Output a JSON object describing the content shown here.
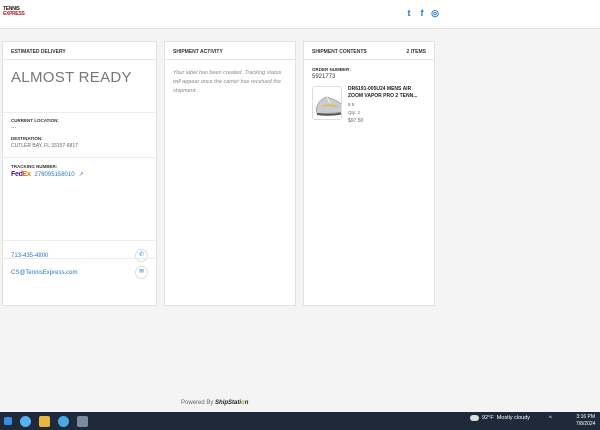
{
  "header": {
    "logo_line1": "TENNIS",
    "logo_line2": "EXPRESS",
    "social": [
      {
        "icon": "twitter-icon",
        "glyph": "t"
      },
      {
        "icon": "facebook-icon",
        "glyph": "f"
      },
      {
        "icon": "instagram-icon",
        "glyph": "◎"
      }
    ]
  },
  "delivery": {
    "heading": "ESTIMATED DELIVERY",
    "status": "ALMOST READY",
    "current_location_label": "CURRENT LOCATION:",
    "current_location_value": "---",
    "destination_label": "DESTINATION:",
    "destination_value": "CUTLER BAY, FL 33157-6817",
    "tracking_label": "TRACKING NUMBER:",
    "carrier_fed": "Fed",
    "carrier_ex": "Ex",
    "tracking_number": "276095158010",
    "phone": "713-435-4800",
    "email": "CS@TennisExpress.com"
  },
  "activity": {
    "heading": "SHIPMENT ACTIVITY",
    "message": "Your label has been created. Tracking status will appear once the carrier has received the shipment."
  },
  "contents": {
    "heading": "SHIPMENT CONTENTS",
    "count": "2 ITEMS",
    "order_label": "ORDER NUMBER:",
    "order_number": "5921773",
    "product": {
      "name": "DR6191-005U24 MENS AIR ZOOM VAPOR PRO 2 TENN...",
      "size": "8.5",
      "qty": "Qty: 2",
      "price": "$97.50"
    }
  },
  "footer": {
    "powered_by": "Powered By",
    "brand_pre": "ShipStati",
    "brand_o": "o",
    "brand_post": "n"
  },
  "taskbar": {
    "temp": "92°F",
    "condition": "Mostly cloudy",
    "time": "3:16 PM",
    "date": "7/8/2024"
  },
  "colors": {
    "link": "#2a78c2",
    "taskbar": "#1e2a3a",
    "fedex_purple": "#4d148c",
    "fedex_orange": "#ff6600"
  }
}
